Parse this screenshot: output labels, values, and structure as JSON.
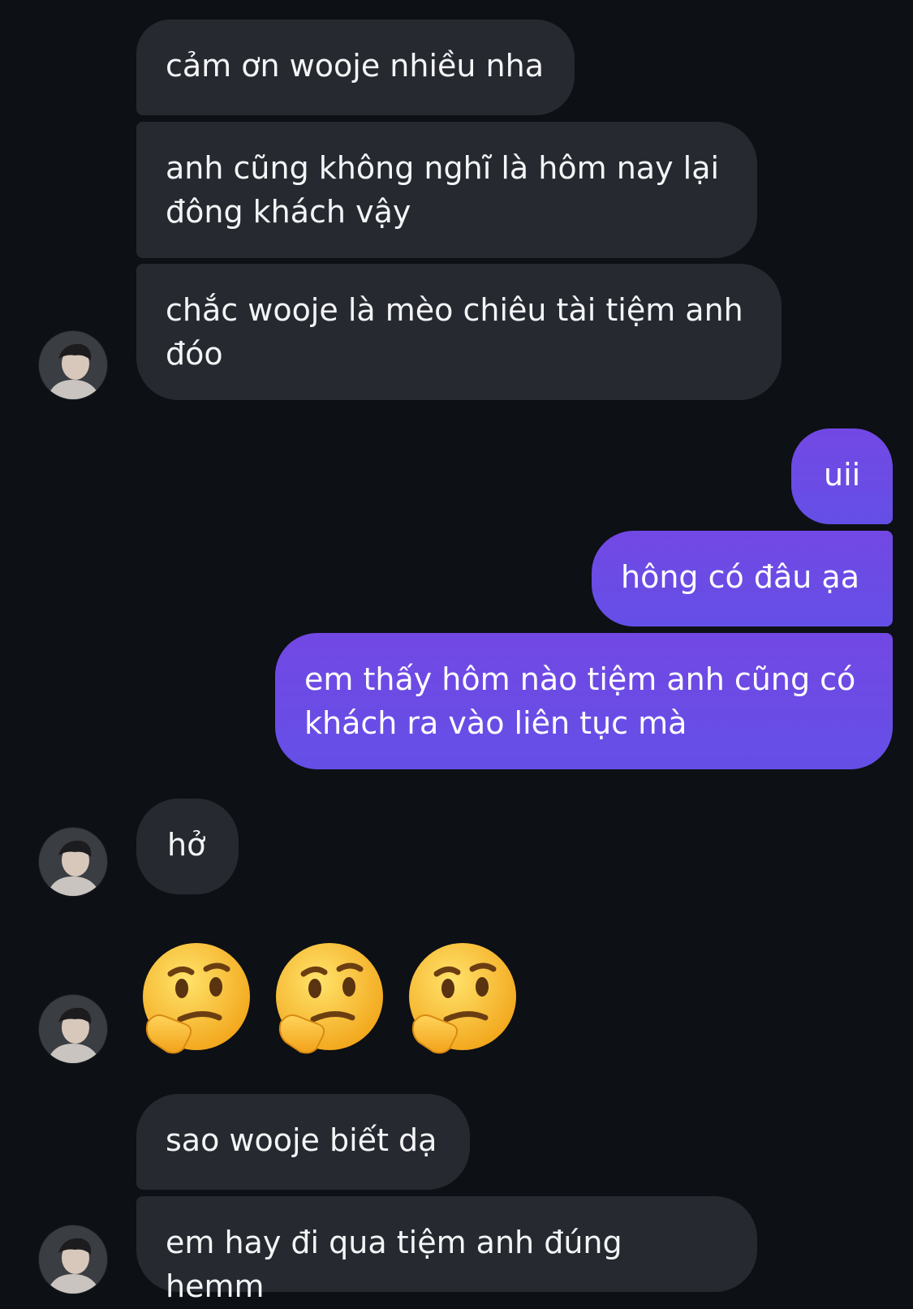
{
  "messages": [
    {
      "id": "m1",
      "side": "in",
      "text": "cảm ơn wooje nhiều nha"
    },
    {
      "id": "m2",
      "side": "in",
      "text": "anh cũng không nghĩ là hôm nay lại\nđông khách vậy"
    },
    {
      "id": "m3",
      "side": "in",
      "text": "chắc wooje là mèo chiêu tài tiệm anh\nđóo"
    },
    {
      "id": "m4",
      "side": "out",
      "text": "uii"
    },
    {
      "id": "m5",
      "side": "out",
      "text": "hông có đâu ạa"
    },
    {
      "id": "m6",
      "side": "out",
      "text": "em thấy hôm nào tiệm anh cũng có\nkhách ra vào liên tục mà"
    },
    {
      "id": "m7",
      "side": "in",
      "text": "hở"
    },
    {
      "id": "m8",
      "side": "in",
      "emoji": [
        "thinking-face",
        "thinking-face",
        "thinking-face"
      ]
    },
    {
      "id": "m9",
      "side": "in",
      "text": "sao wooje biết dạ"
    },
    {
      "id": "m10",
      "side": "in",
      "text": "em hay đi qua tiệm anh đúng hemm"
    }
  ],
  "colors": {
    "background": "#0d1014",
    "incoming_bubble": "#262a30",
    "outgoing_bubble_top": "#7348e4",
    "outgoing_bubble_bottom": "#644fe6",
    "text": "#f4f5f7"
  },
  "avatar_icon": "contact-avatar"
}
